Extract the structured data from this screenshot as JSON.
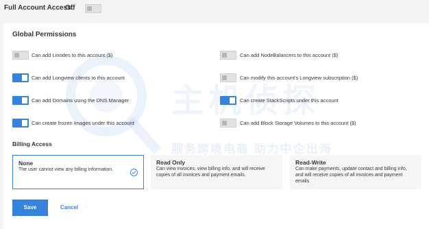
{
  "header": {
    "full_access_label": "Full Account Access:",
    "full_access_state": "Off",
    "full_access_toggle": "off"
  },
  "global_permissions": {
    "title": "Global Permissions",
    "items": [
      {
        "label": "Can add Linodes to this account ($)",
        "state": "off"
      },
      {
        "label": "Can add NodeBalancers to this account ($)",
        "state": "off"
      },
      {
        "label": "Can add Longview clients to this account",
        "state": "on"
      },
      {
        "label": "Can modify this account's Longview subscription ($)",
        "state": "off"
      },
      {
        "label": "Can add Domains using the DNS Manager",
        "state": "on"
      },
      {
        "label": "Can create StackScripts under this account",
        "state": "on"
      },
      {
        "label": "Can create frozen Images under this account",
        "state": "on"
      },
      {
        "label": "Can add Block Storage Volumes to this account ($)",
        "state": "off"
      }
    ]
  },
  "billing": {
    "title": "Billing Access",
    "options": [
      {
        "title": "None",
        "description": "The user cannot view any billing information.",
        "selected": true
      },
      {
        "title": "Read Only",
        "description": "Can view invoices, view billing info, and will receive copies of all invoices and payment emails.",
        "selected": false
      },
      {
        "title": "Read-Write",
        "description": "Can make payments, update contact and billing info, and will receive copies of all invoices and payment emails",
        "selected": false
      }
    ]
  },
  "actions": {
    "save_label": "Save",
    "cancel_label": "Cancel"
  },
  "watermark": {
    "main_text": "主机侦探",
    "sub_text": "服务跨境电商 助力中企出海"
  },
  "colors": {
    "accent": "#3683dc",
    "toggle_off": "#e2e2e2",
    "text": "#32363c"
  }
}
